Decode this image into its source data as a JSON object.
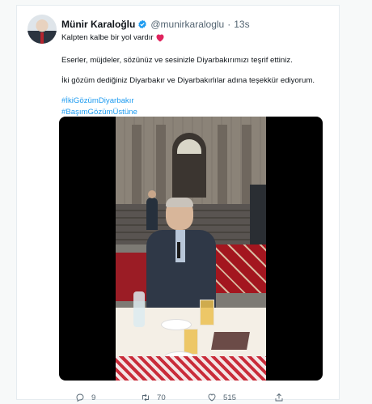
{
  "tweet": {
    "author_name": "Münir Karaloğlu",
    "handle": "@munirkaraloglu",
    "separator": "·",
    "time": "13s",
    "lines": {
      "line1": "Kalpten kalbe bir yol vardır",
      "line2": "Eserler, müjdeler, sözünüz ve sesinizle Diyarbakırımızı teşrif ettiniz.",
      "line3": "İki gözüm dediğiniz Diyarbakır ve Diyarbakırlılar adına teşekkür ediyorum."
    },
    "hashtags": [
      "#İkiGözümDiyarbakır",
      "#BaşımGözümÜstüne"
    ]
  },
  "actions": {
    "reply_count": "9",
    "retweet_count": "70",
    "like_count": "515"
  },
  "colors": {
    "link": "#1d9bf0",
    "verified": "#1d9bf0",
    "heart": "#e0245e",
    "muted": "#536471"
  },
  "icons": [
    "verified-badge-icon",
    "red-heart-emoji-icon",
    "reply-icon",
    "retweet-icon",
    "like-icon",
    "share-icon"
  ]
}
